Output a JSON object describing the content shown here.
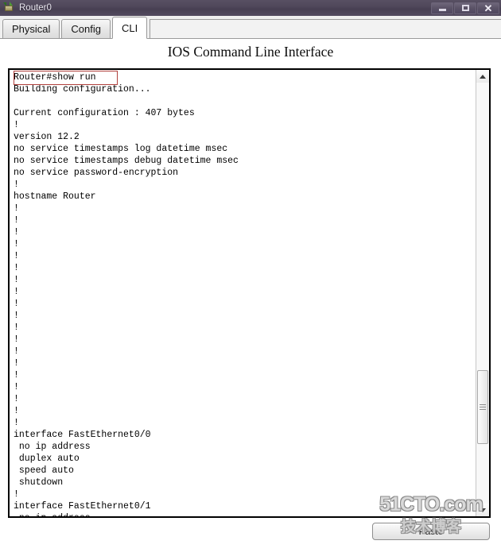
{
  "window": {
    "title": "Router0",
    "icon": "router-icon",
    "controls": {
      "minimize_label": "–",
      "maximize_label": "□",
      "close_label": "✕"
    }
  },
  "tabs": [
    {
      "label": "Physical",
      "active": false
    },
    {
      "label": "Config",
      "active": false
    },
    {
      "label": "CLI",
      "active": true
    }
  ],
  "header": {
    "title": "IOS Command Line Interface"
  },
  "terminal": {
    "highlighted_command": "Router#show run",
    "lines": [
      "Router#show run",
      "Building configuration...",
      "",
      "Current configuration : 407 bytes",
      "!",
      "version 12.2",
      "no service timestamps log datetime msec",
      "no service timestamps debug datetime msec",
      "no service password-encryption",
      "!",
      "hostname Router",
      "!",
      "!",
      "!",
      "!",
      "!",
      "!",
      "!",
      "!",
      "!",
      "!",
      "!",
      "!",
      "!",
      "!",
      "!",
      "!",
      "!",
      "!",
      "!",
      "interface FastEthernet0/0",
      " no ip address",
      " duplex auto",
      " speed auto",
      " shutdown",
      "!",
      "interface FastEthernet0/1",
      " no ip address"
    ]
  },
  "scrollbar": {
    "up_arrow": "scroll-up-arrow",
    "down_arrow": "scroll-down-arrow"
  },
  "bottom": {
    "paste_label": "Paste"
  },
  "watermark": {
    "line1": "51CTO.com",
    "line2": "技术博客"
  },
  "colors": {
    "titlebar": "#4e4659",
    "highlight_border": "#b0403c",
    "terminal_border": "#000000",
    "tab_active_bg": "#ffffff"
  }
}
